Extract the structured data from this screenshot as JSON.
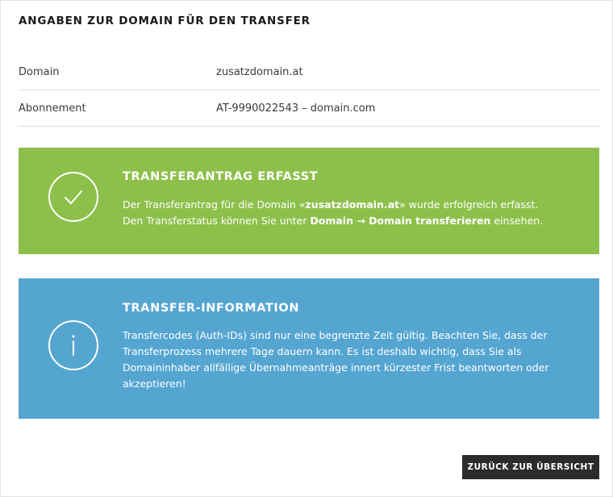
{
  "section": {
    "title": "ANGABEN ZUR DOMAIN FÜR DEN TRANSFER"
  },
  "details": [
    {
      "label": "Domain",
      "value": "zusatzdomain.at"
    },
    {
      "label": "Abonnement",
      "value": "AT-9990022543 – domain.com"
    }
  ],
  "success_notice": {
    "title": "TRANSFERANTRAG ERFASST",
    "line1_prefix": "Der Transferantrag für die Domain «",
    "line1_domain": "zusatzdomain.at",
    "line1_suffix": "» wurde erfolgreich erfasst.",
    "line2_prefix": "Den Transferstatus können Sie unter ",
    "line2_path": "Domain → Domain transferieren",
    "line2_suffix": " einsehen.",
    "icon": "checkmark-icon",
    "color": "#8cc04b"
  },
  "info_notice": {
    "title": "TRANSFER-INFORMATION",
    "text": "Transfercodes (Auth-IDs) sind nur eine begrenzte Zeit gültig. Beachten Sie, dass der Transferprozess mehrere Tage dauern kann. Es ist deshalb wichtig, dass Sie als Domaininhaber allfällige Übernahmeanträge innert kürzester Frist beantworten oder akzeptieren!",
    "icon": "info-icon",
    "color": "#55a5d1"
  },
  "actions": {
    "back_label": "ZURÜCK ZUR ÜBERSICHT"
  }
}
